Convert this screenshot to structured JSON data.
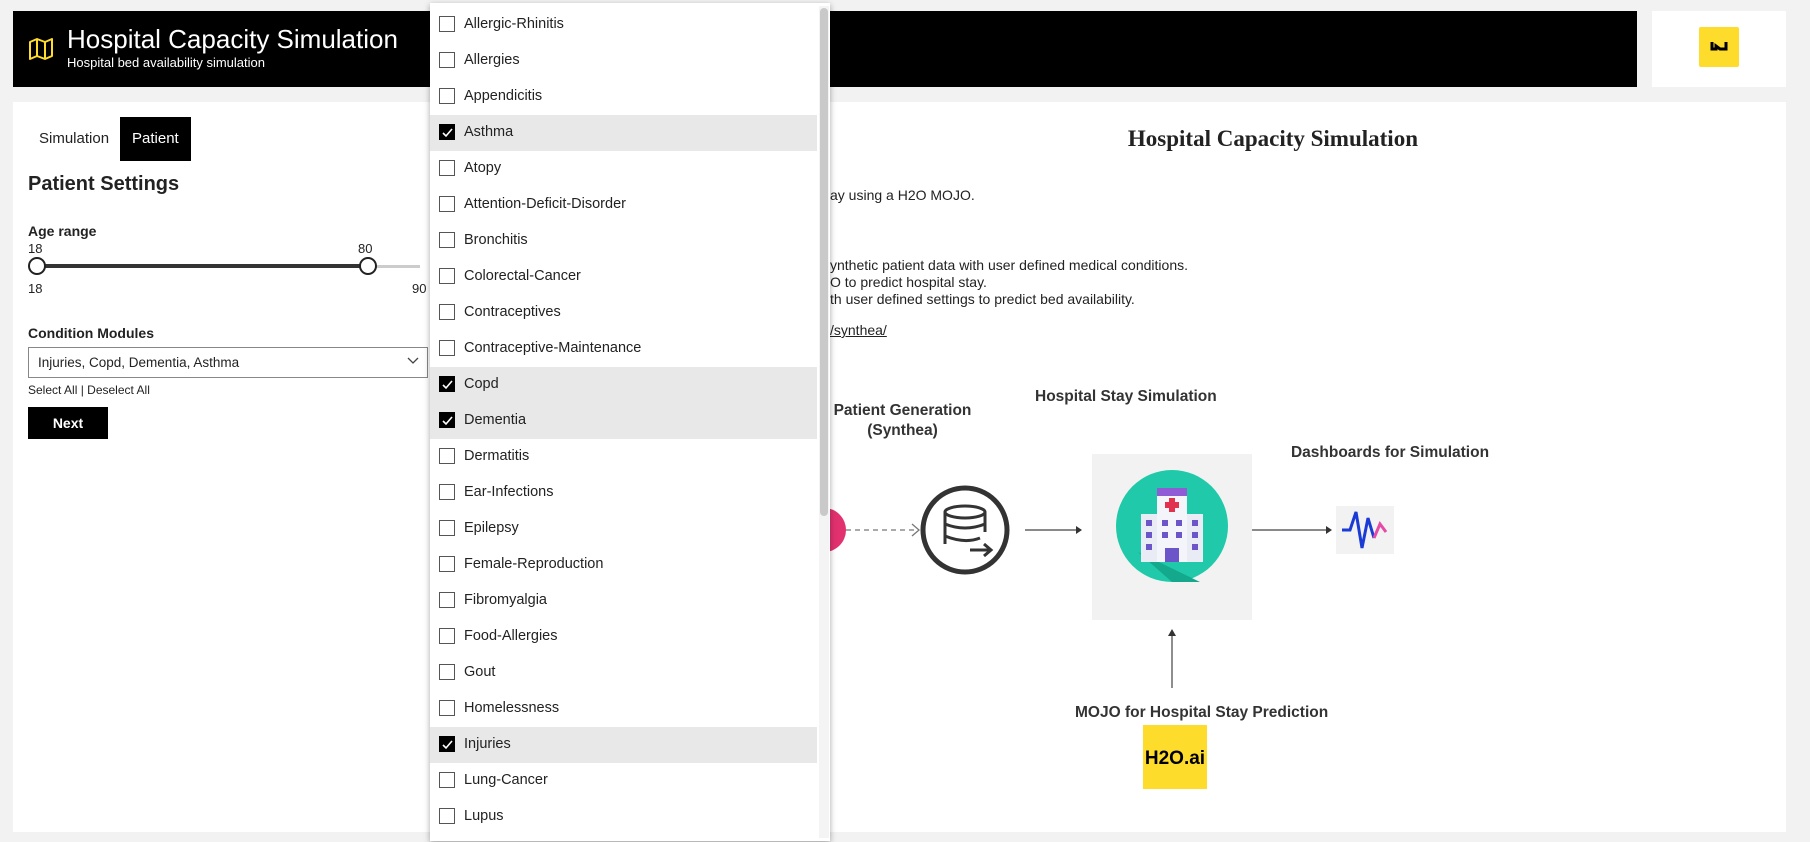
{
  "header": {
    "title": "Hospital Capacity Simulation",
    "subtitle": "Hospital bed availability simulation",
    "map_icon": "map-icon",
    "logo_icon": "h2o-wave-logo"
  },
  "sidebar": {
    "tabs": [
      {
        "label": "Simulation",
        "active": false
      },
      {
        "label": "Patient",
        "active": true
      }
    ],
    "heading": "Patient Settings",
    "age_range": {
      "label": "Age range",
      "min": 18,
      "max": 90,
      "low": 18,
      "high": 80,
      "min_label": "18",
      "max_label": "90",
      "low_label": "18",
      "high_label": "80"
    },
    "conditions": {
      "label": "Condition Modules",
      "value": "Injuries, Copd, Dementia, Asthma",
      "select_all": "Select All",
      "separator": "|",
      "deselect_all": "Deselect All"
    },
    "next_label": "Next"
  },
  "main": {
    "title": "Hospital Capacity Simulation",
    "lines": [
      "ay using a H2O MOJO.",
      "ynthetic patient data with user defined medical conditions.",
      "O to predict hospital stay.",
      "th user defined settings to predict bed availability.",
      "/synthea/"
    ],
    "diagram": {
      "patient_gen": [
        "Patient Generation",
        "(Synthea)"
      ],
      "hospital_stay": "Hospital Stay Simulation",
      "dashboards": "Dashboards for Simulation",
      "mojo": "MOJO for Hospital Stay Prediction",
      "h2o_logo": "H2O.ai"
    }
  },
  "dropdown": {
    "options": [
      {
        "label": "Allergic-Rhinitis",
        "checked": false
      },
      {
        "label": "Allergies",
        "checked": false
      },
      {
        "label": "Appendicitis",
        "checked": false
      },
      {
        "label": "Asthma",
        "checked": true
      },
      {
        "label": "Atopy",
        "checked": false
      },
      {
        "label": "Attention-Deficit-Disorder",
        "checked": false
      },
      {
        "label": "Bronchitis",
        "checked": false
      },
      {
        "label": "Colorectal-Cancer",
        "checked": false
      },
      {
        "label": "Contraceptives",
        "checked": false
      },
      {
        "label": "Contraceptive-Maintenance",
        "checked": false
      },
      {
        "label": "Copd",
        "checked": true
      },
      {
        "label": "Dementia",
        "checked": true
      },
      {
        "label": "Dermatitis",
        "checked": false
      },
      {
        "label": "Ear-Infections",
        "checked": false
      },
      {
        "label": "Epilepsy",
        "checked": false
      },
      {
        "label": "Female-Reproduction",
        "checked": false
      },
      {
        "label": "Fibromyalgia",
        "checked": false
      },
      {
        "label": "Food-Allergies",
        "checked": false
      },
      {
        "label": "Gout",
        "checked": false
      },
      {
        "label": "Homelessness",
        "checked": false
      },
      {
        "label": "Injuries",
        "checked": true
      },
      {
        "label": "Lung-Cancer",
        "checked": false
      },
      {
        "label": "Lupus",
        "checked": false
      }
    ]
  },
  "colors": {
    "accent": "#000000",
    "brand_yellow": "#fddc2c",
    "checked_row": "#e8e8e8"
  }
}
